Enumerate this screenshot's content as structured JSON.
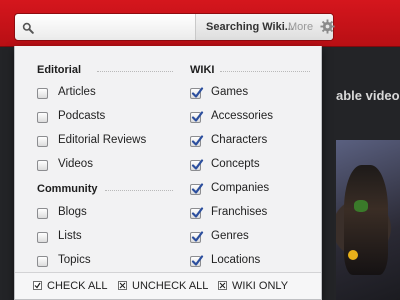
{
  "search": {
    "placeholder": "",
    "scope_label": "Searching Wiki...",
    "more_label": "More"
  },
  "background": {
    "partial_text": "able video"
  },
  "editorial": {
    "title": "Editorial",
    "items": [
      {
        "label": "Articles",
        "checked": false
      },
      {
        "label": "Podcasts",
        "checked": false
      },
      {
        "label": "Editorial Reviews",
        "checked": false
      },
      {
        "label": "Videos",
        "checked": false
      }
    ]
  },
  "community": {
    "title": "Community",
    "items": [
      {
        "label": "Blogs",
        "checked": false
      },
      {
        "label": "Lists",
        "checked": false
      },
      {
        "label": "Topics",
        "checked": false
      }
    ]
  },
  "wiki": {
    "title": "WIKI",
    "items": [
      {
        "label": "Games",
        "checked": true
      },
      {
        "label": "Accessories",
        "checked": true
      },
      {
        "label": "Characters",
        "checked": true
      },
      {
        "label": "Concepts",
        "checked": true
      },
      {
        "label": "Companies",
        "checked": true
      },
      {
        "label": "Franchises",
        "checked": true
      },
      {
        "label": "Genres",
        "checked": true
      },
      {
        "label": "Locations",
        "checked": true
      }
    ]
  },
  "footer": {
    "check_all": "CHECK ALL",
    "uncheck_all": "UNCHECK ALL",
    "wiki_only": "WIKI ONLY"
  },
  "colors": {
    "brand_red": "#c8121a",
    "check_blue": "#2c4f9e"
  }
}
